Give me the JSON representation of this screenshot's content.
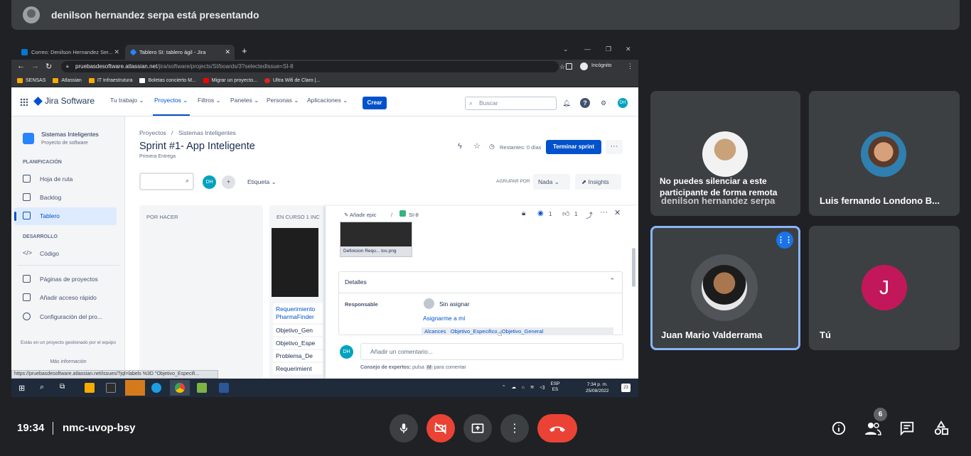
{
  "meet": {
    "presenter_text": "denilson hernandez serpa está presentando",
    "time": "19:34",
    "meeting_code": "nmc-uvop-bsy",
    "participants_badge": "6"
  },
  "browser": {
    "tabs": [
      {
        "label": "Correo: Denilson Hernandez Ser...",
        "color": "#0078d4"
      },
      {
        "label": "Tablero SI: tablero ágil - Jira",
        "color": "#0052cc"
      }
    ],
    "url_host": "pruebasdesoftware.atlassian.net",
    "url_path": "/jira/software/projects/SI/boards/3?selectedIssue=SI-8",
    "incognito_label": "Incógnito",
    "bookmarks": [
      "SENSAS",
      "Atlassian",
      "IT Infraestrutura",
      "Boletas concierto M...",
      "Migrar un proyecto...",
      "Ultra Wifi de Claro |..."
    ],
    "status_url": "https://pruebasdesoftware.atlassian.net/issues/?jql=labels %3D \"Objetivo_Especifi..."
  },
  "jira": {
    "logo": "Jira Software",
    "menu": [
      "Tu trabajo ⌄",
      "Proyectos ⌄",
      "Filtros ⌄",
      "Paneles ⌄",
      "Personas ⌄",
      "Aplicaciones ⌄"
    ],
    "create": "Crear",
    "search_placeholder": "Buscar",
    "avatar_initials": "DH",
    "sidebar": {
      "project_name": "Sistemas Inteligentes",
      "project_type": "Proyecto de software",
      "planning_header": "PLANIFICACIÓN",
      "items_planning": [
        "Hoja de ruta",
        "Backlog",
        "Tablero"
      ],
      "dev_header": "DESARROLLO",
      "items_dev": [
        "Código"
      ],
      "items_other": [
        "Páginas de proyectos",
        "Añadir acceso rápido",
        "Configuración del pro..."
      ],
      "footer": "Estás en un proyecto gestionado por el equipo",
      "more_info": "Más información"
    },
    "board": {
      "breadcrumb_1": "Proyectos",
      "breadcrumb_sep": "/",
      "breadcrumb_2": "Sistemas Inteligentes",
      "title": "Sprint #1- App Inteligente",
      "subtitle": "Primera Entrega",
      "remaining": "Restantes: 0 días",
      "finish_sprint": "Terminar sprint",
      "label_filter": "Etiqueta",
      "group_by_label": "AGRUPAR POR",
      "group_by_value": "Nada",
      "insights": "Insights",
      "columns": [
        "POR HACER",
        "EN CURSO 1 INC"
      ],
      "card_items": [
        "Requerimiento PharmaFinder",
        "Objetivo_Gen",
        "Objetivo_Espe",
        "Problema_De",
        "Requerimient"
      ]
    },
    "issue": {
      "add_epic": "Añadir epic",
      "issue_key": "SI-8",
      "watchers": "1",
      "votes": "1",
      "attachment_name": "Definicion Requ... tos.png",
      "details_header": "Detalles",
      "assignee_label": "Responsable",
      "assignee_value": "Sin asignar",
      "assign_me": "Asignarme a mí",
      "labels": [
        "Alcances",
        "Objetivo_Especifico",
        "Objetivo_General"
      ],
      "comment_placeholder": "Añadir un comentario...",
      "tip_bold": "Consejo de expertos:",
      "tip_text": "pulsa",
      "tip_key": "M",
      "tip_text2": "para comentar"
    }
  },
  "taskbar": {
    "lang": "ESP",
    "lang2": "ES",
    "time": "7:34 p. m.",
    "date": "25/08/2022",
    "notif": "23"
  },
  "participants": [
    {
      "name": "denilson hernandez serpa",
      "overlay": "No puedes silenciar a este participante de forma remota"
    },
    {
      "name": "Luis fernando Londono B..."
    },
    {
      "name": "Juan Mario Valderrama"
    },
    {
      "name": "Tú",
      "initial": "J"
    }
  ],
  "colors": {
    "meet_bg": "#202124",
    "tile_bg": "#3c4043",
    "jira_blue": "#0052cc",
    "hangup": "#ea4335",
    "active_speaker": "#8ab4f8",
    "you_avatar": "#c2185b"
  }
}
